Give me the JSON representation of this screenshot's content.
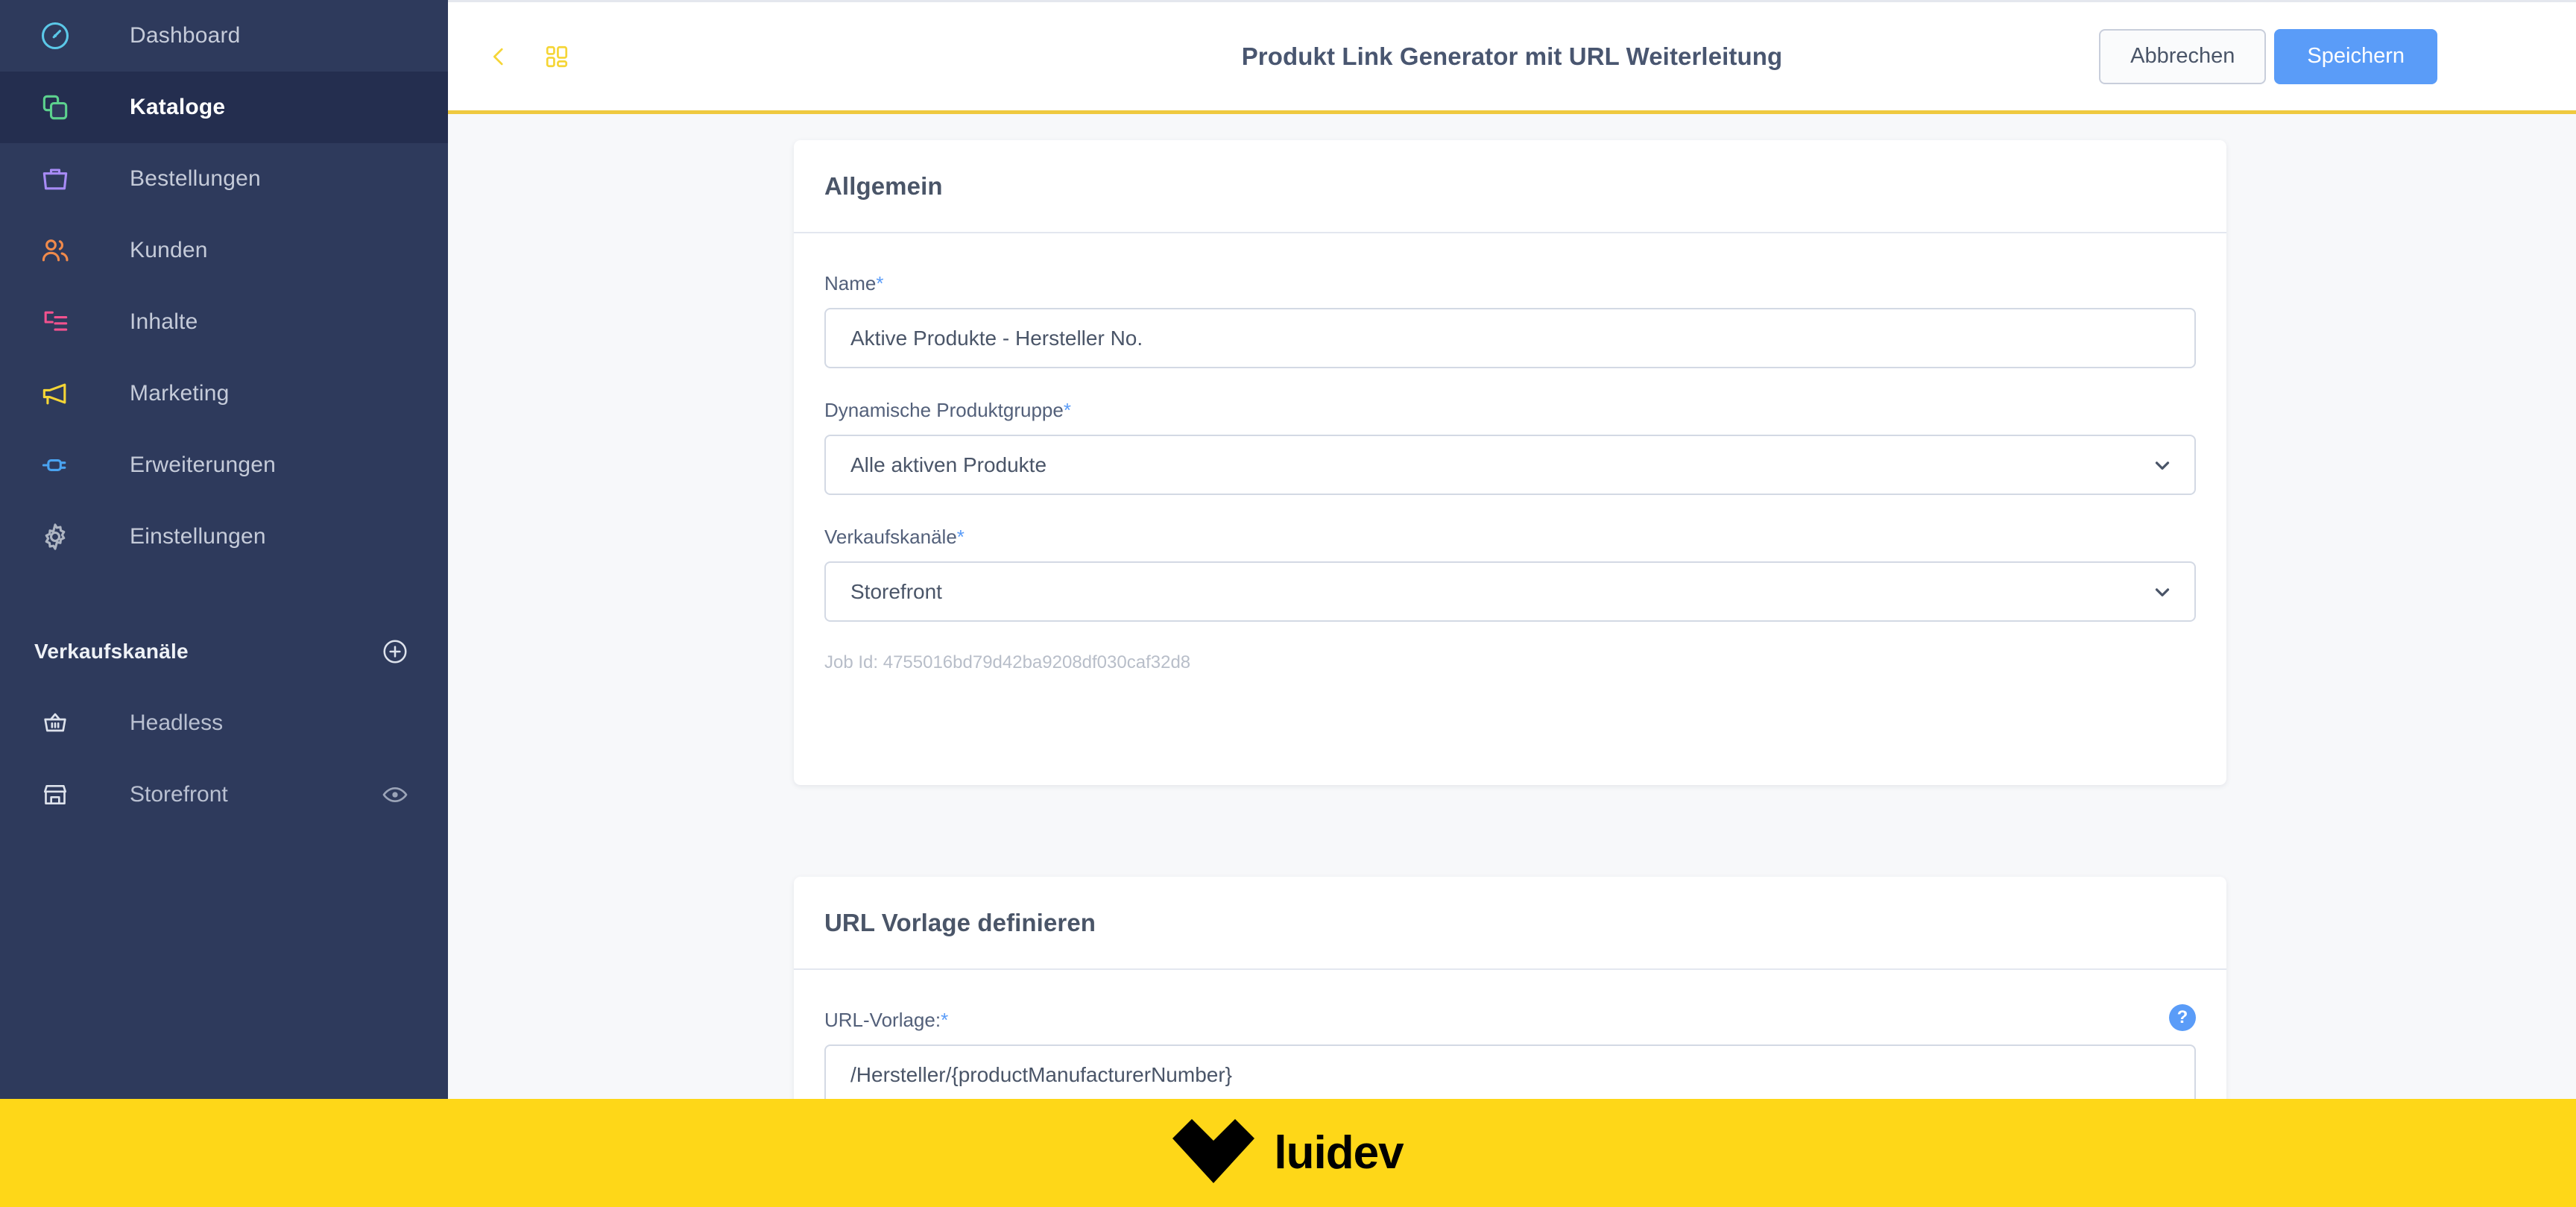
{
  "sidebar": {
    "nav_items": [
      {
        "label": "Dashboard",
        "icon": "gauge-icon",
        "color": "#5BC8E8",
        "active": false
      },
      {
        "label": "Kataloge",
        "icon": "layers-icon",
        "color": "#5CD18E",
        "active": true
      },
      {
        "label": "Bestellungen",
        "icon": "briefcase-icon",
        "color": "#A78BF5",
        "active": false
      },
      {
        "label": "Kunden",
        "icon": "users-icon",
        "color": "#F08A4B",
        "active": false
      },
      {
        "label": "Inhalte",
        "icon": "content-icon",
        "color": "#F2528E",
        "active": false
      },
      {
        "label": "Marketing",
        "icon": "megaphone-icon",
        "color": "#F5D536",
        "active": false
      },
      {
        "label": "Erweiterungen",
        "icon": "plug-icon",
        "color": "#4AA3F0",
        "active": false
      },
      {
        "label": "Einstellungen",
        "icon": "gear-icon",
        "color": "#AEB5C2",
        "active": false
      }
    ],
    "section": {
      "title": "Verkaufskanäle",
      "add_icon": "plus-circle-icon"
    },
    "channels": [
      {
        "label": "Headless",
        "icon": "basket-icon",
        "action_icon": null
      },
      {
        "label": "Storefront",
        "icon": "store-icon",
        "action_icon": "eye-icon"
      }
    ]
  },
  "header": {
    "back_icon": "chevron-left-icon",
    "grid_icon": "grid-icon",
    "title": "Produkt Link Generator mit URL Weiterleitung",
    "cancel_label": "Abbrechen",
    "save_label": "Speichern",
    "accent_color": "#EFC93F"
  },
  "main": {
    "cards": [
      {
        "title": "Allgemein",
        "fields": [
          {
            "label": "Name",
            "required_mark": "*",
            "value": "Aktive Produkte - Hersteller No.",
            "type": "text"
          },
          {
            "label": "Dynamische Produktgruppe",
            "required_mark": "*",
            "value": "Alle aktiven Produkte",
            "type": "select",
            "chevron": "chevron-down-icon"
          },
          {
            "label": "Verkaufskanäle",
            "required_mark": "*",
            "value": "Storefront",
            "type": "select",
            "chevron": "chevron-down-icon"
          }
        ],
        "job_id": "Job Id: 4755016bd79d42ba9208df030caf32d8"
      },
      {
        "title": "URL Vorlage definieren",
        "fields": [
          {
            "label": "URL-Vorlage:",
            "required_mark": "*",
            "value": "/Hersteller/{productManufacturerNumber}",
            "type": "text",
            "help_icon": "question-mark-icon",
            "help_label": "?"
          }
        ]
      }
    ]
  },
  "footer": {
    "logo_icon": "heart-logo-icon",
    "brand": "luidev",
    "background": "#FED718"
  }
}
